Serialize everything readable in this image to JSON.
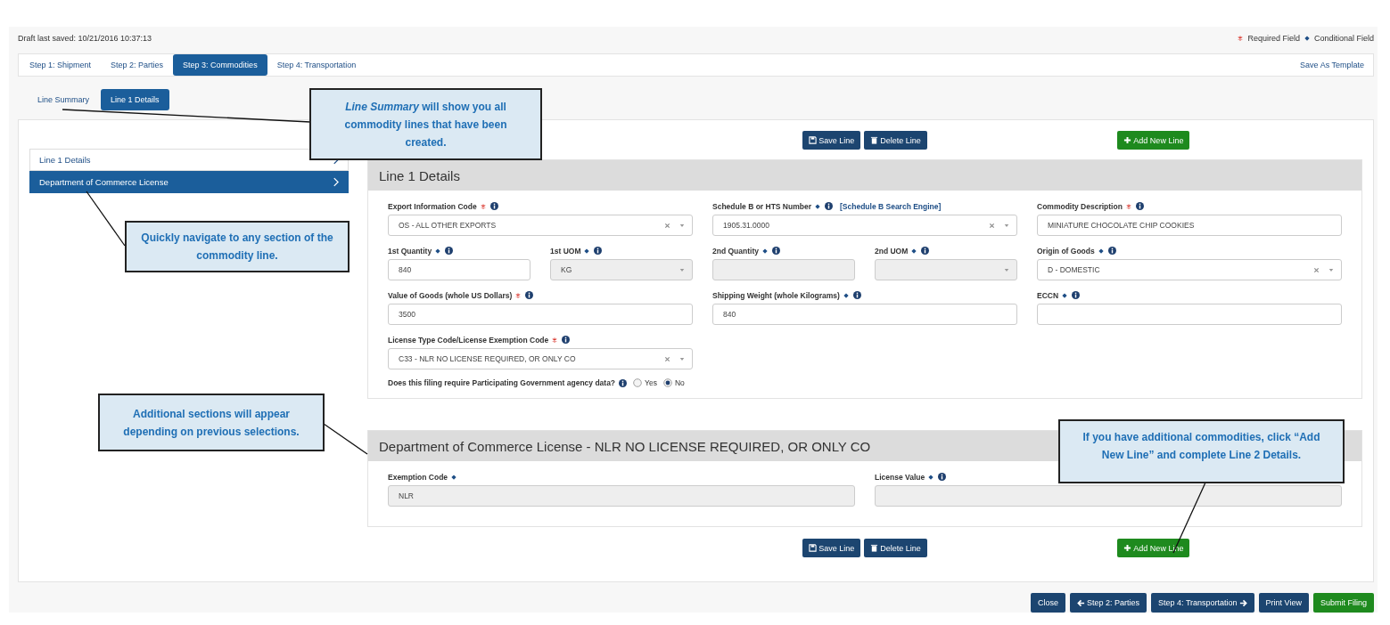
{
  "draft_saved": "Draft last saved: 10/21/2016 10:37:13",
  "legend": [
    {
      "kind": "required",
      "label": "Required Field"
    },
    {
      "kind": "conditional",
      "label": "Conditional Field"
    }
  ],
  "steps": [
    {
      "label": "Step 1: Shipment",
      "selected": false
    },
    {
      "label": "Step 2: Parties",
      "selected": false
    },
    {
      "label": "Step 3: Commodities",
      "selected": true
    },
    {
      "label": "Step 4: Transportation",
      "selected": false
    }
  ],
  "save_template": "Save As Template",
  "subtabs": [
    {
      "label": "Line Summary",
      "selected": false
    },
    {
      "label": "Line 1 Details",
      "selected": true
    }
  ],
  "nav": [
    {
      "label": "Line 1 Details",
      "selected": false
    },
    {
      "label": "Department of Commerce License",
      "selected": true
    }
  ],
  "top_buttons": [
    {
      "kind": "save",
      "label": "Save Line"
    },
    {
      "kind": "delete",
      "label": "Delete Line"
    },
    {
      "kind": "add",
      "label": "Add New Line"
    }
  ],
  "sections": [
    {
      "kind": "line_details",
      "title": "Line 1 Details",
      "rows": [
        {
          "columns": [
            {
              "fields": [
                {
                  "label": "Export Information Code",
                  "required": true,
                  "info": true,
                  "kind": "select",
                  "value": "OS - ALL OTHER EXPORTS",
                  "disabled": false,
                  "clearable": true
                }
              ]
            },
            {
              "fields": [
                {
                  "label": "Schedule B or HTS Number",
                  "required": false,
                  "info": true,
                  "link": "[Schedule B Search Engine]",
                  "kind": "select",
                  "value": "1905.31.0000",
                  "disabled": false,
                  "clearable": true
                }
              ]
            },
            {
              "fields": [
                {
                  "label": "Commodity Description",
                  "required": true,
                  "info": true,
                  "kind": "text",
                  "value": "MINIATURE CHOCOLATE CHIP COOKIES",
                  "disabled": false
                }
              ]
            }
          ]
        },
        {
          "columns": [
            {
              "fields": [
                {
                  "label": "1st Quantity",
                  "required": false,
                  "info": true,
                  "kind": "text",
                  "value": "840",
                  "disabled": false
                },
                {
                  "label": "1st UOM",
                  "required": false,
                  "info": true,
                  "kind": "select",
                  "value": "KG",
                  "disabled": true,
                  "clearable": false
                }
              ]
            },
            {
              "fields": [
                {
                  "label": "2nd Quantity",
                  "required": false,
                  "info": true,
                  "kind": "text",
                  "disabled": true
                },
                {
                  "label": "2nd UOM",
                  "required": false,
                  "info": true,
                  "kind": "select",
                  "disabled": true,
                  "clearable": false
                }
              ]
            },
            {
              "fields": [
                {
                  "label": "Origin of Goods",
                  "required": false,
                  "info": true,
                  "kind": "select",
                  "value": "D - DOMESTIC",
                  "disabled": false,
                  "clearable": true
                }
              ]
            }
          ]
        },
        {
          "columns": [
            {
              "fields": [
                {
                  "label": "Value of Goods (whole US Dollars)",
                  "required": true,
                  "info": true,
                  "kind": "text",
                  "value": "3500",
                  "disabled": false
                }
              ]
            },
            {
              "fields": [
                {
                  "label": "Shipping Weight (whole Kilograms)",
                  "required": false,
                  "info": true,
                  "kind": "text",
                  "value": "840",
                  "disabled": false
                }
              ]
            },
            {
              "fields": [
                {
                  "label": "ECCN",
                  "required": false,
                  "info": true,
                  "kind": "text",
                  "disabled": false
                }
              ]
            }
          ]
        },
        {
          "columns": [
            {
              "fields": [
                {
                  "label": "License Type Code/License Exemption Code",
                  "required": true,
                  "info": true,
                  "kind": "select",
                  "value": "C33 - NLR NO LICENSE REQUIRED, OR ONLY CO",
                  "disabled": false,
                  "clearable": true
                }
              ]
            }
          ]
        }
      ],
      "question": {
        "label": "Does this filing require Participating Government agency data?",
        "info": true,
        "options": [
          {
            "label": "Yes",
            "selected": false
          },
          {
            "label": "No",
            "selected": true
          }
        ]
      }
    },
    {
      "kind": "license",
      "title": "Department of Commerce License - NLR NO LICENSE REQUIRED, OR ONLY CO",
      "rows": [
        {
          "columns": [
            {
              "fields": [
                {
                  "label": "Exemption Code",
                  "required": false,
                  "info": false,
                  "kind": "text",
                  "value": "NLR",
                  "disabled": true
                }
              ]
            },
            {
              "fields": [
                {
                  "label": "License Value",
                  "required": false,
                  "info": true,
                  "kind": "text",
                  "disabled": true
                }
              ]
            }
          ]
        }
      ]
    }
  ],
  "bottom_buttons": [
    {
      "kind": "save",
      "label": "Save Line"
    },
    {
      "kind": "delete",
      "label": "Delete Line"
    },
    {
      "kind": "add",
      "label": "Add New Line"
    }
  ],
  "footer_buttons": [
    {
      "kind": "primary",
      "label": "Close"
    },
    {
      "kind": "back",
      "label": "Step 2: Parties"
    },
    {
      "kind": "next",
      "label": "Step 4: Transportation"
    },
    {
      "kind": "primary",
      "label": "Print View"
    },
    {
      "kind": "submit",
      "label": "Submit Filing"
    }
  ],
  "callouts": [
    {
      "text": "*Line Summary* will show you all commodity lines that have been created."
    },
    {
      "text": "Quickly navigate to any section of the commodity line."
    },
    {
      "text": "Additional sections will appear depending on previous selections."
    },
    {
      "text": "If you have additional commodities, click “Add New Line” and complete Line 2 Details."
    }
  ]
}
